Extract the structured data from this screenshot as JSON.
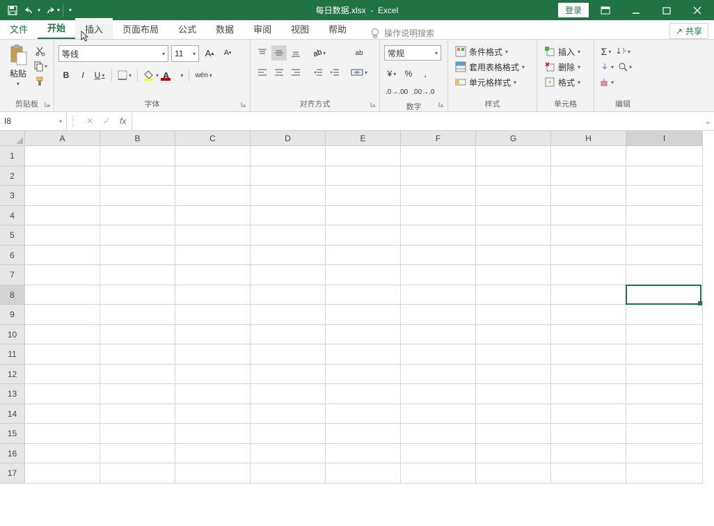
{
  "titlebar": {
    "filename": "每日数据.xlsx",
    "app": "Excel",
    "login": "登录"
  },
  "tabs": {
    "file": "文件",
    "home": "开始",
    "insert": "插入",
    "page_layout": "页面布局",
    "formulas": "公式",
    "data": "数据",
    "review": "审阅",
    "view": "视图",
    "help": "帮助",
    "tell_me": "操作说明搜索"
  },
  "share": "共享",
  "ribbon": {
    "clipboard": {
      "label": "剪贴板",
      "paste": "粘贴"
    },
    "font": {
      "label": "字体",
      "name": "等线",
      "size": "11",
      "bold": "B",
      "italic": "I",
      "underline": "U",
      "phonetic": "wén"
    },
    "alignment": {
      "label": "对齐方式",
      "wrap": "ab"
    },
    "number": {
      "label": "数字",
      "format": "常规",
      "percent": "%",
      "comma": ",",
      "currency": "¥"
    },
    "styles": {
      "label": "样式",
      "conditional": "条件格式",
      "table": "套用表格格式",
      "cell": "单元格样式"
    },
    "cells": {
      "label": "单元格",
      "insert": "插入",
      "delete": "删除",
      "format": "格式"
    },
    "editing": {
      "label": "编辑"
    }
  },
  "formula_bar": {
    "name_box": "I8",
    "fx": "fx",
    "formula": ""
  },
  "grid": {
    "columns": [
      "A",
      "B",
      "C",
      "D",
      "E",
      "F",
      "G",
      "H",
      "I"
    ],
    "rows": [
      "1",
      "2",
      "3",
      "4",
      "5",
      "6",
      "7",
      "8",
      "9",
      "10",
      "11",
      "12",
      "13",
      "14",
      "15",
      "16",
      "17"
    ],
    "selected_col": 8,
    "selected_row": 7
  }
}
